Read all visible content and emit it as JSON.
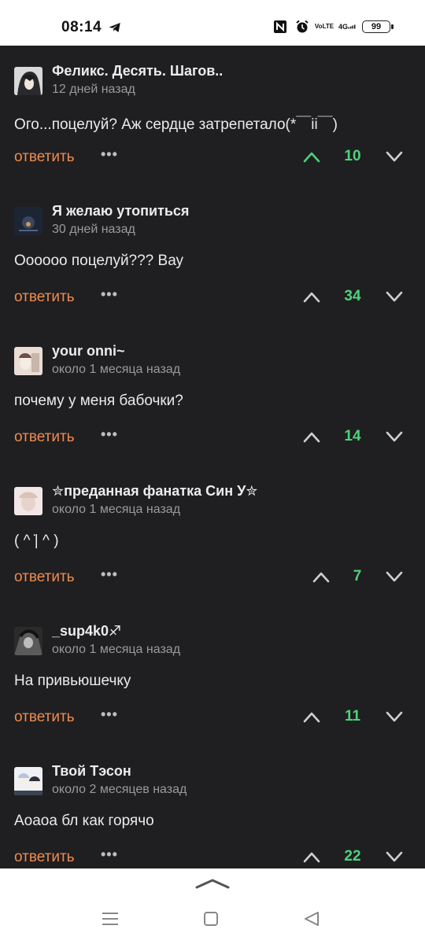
{
  "status_bar": {
    "time": "08:14",
    "icons": [
      "telegram-icon",
      "nfc-icon",
      "alarm-icon",
      "volte-icon",
      "signal-4g-icon",
      "battery-icon"
    ],
    "volte_text_1": "Vo",
    "volte_text_2": "LTE",
    "network": "4G",
    "battery": "99"
  },
  "comments": [
    {
      "author": "Феликс. Десять. Шагов..",
      "date": "12 дней назад",
      "text": "Ого...поцелуй? Аж сердце затрепетало(*￣ii￣)",
      "reply_label": "ответить",
      "more": "•••",
      "votes": "10",
      "upvoted": true
    },
    {
      "author": "Я желаю утопиться",
      "date": "30 дней назад",
      "text": "Оооооо поцелуй??? Вау",
      "reply_label": "ответить",
      "more": "•••",
      "votes": "34",
      "upvoted": false
    },
    {
      "author": "your onni~",
      "date": "около 1 месяца назад",
      "text": "почему у меня бабочки?",
      "reply_label": "ответить",
      "more": "•••",
      "votes": "14",
      "upvoted": false
    },
    {
      "author": "✮преданная фанатка Син У✮",
      "date": "около 1 месяца назад",
      "text": "( ^ ̇| ^ )",
      "reply_label": "ответить",
      "more": "•••",
      "votes": "7",
      "upvoted": false
    },
    {
      "author": "_sup4k0♐",
      "date": "около 1 месяца назад",
      "text": "На привьюшечку",
      "reply_label": "ответить",
      "more": "•••",
      "votes": "11",
      "upvoted": false
    },
    {
      "author": "Твой Тэсон",
      "date": "около 2 месяцев назад",
      "text": "Аоаоа бл как горячо",
      "reply_label": "ответить",
      "more": "•••",
      "votes": "22",
      "upvoted": false
    }
  ],
  "colors": {
    "background": "#1f1f21",
    "reply": "#f08b50",
    "vote_count": "#4cd37a",
    "upvote_active": "#4cd37a",
    "icon": "#cfcfcf"
  },
  "nav": {
    "icons": [
      "menu-icon",
      "home-icon",
      "back-icon"
    ]
  }
}
